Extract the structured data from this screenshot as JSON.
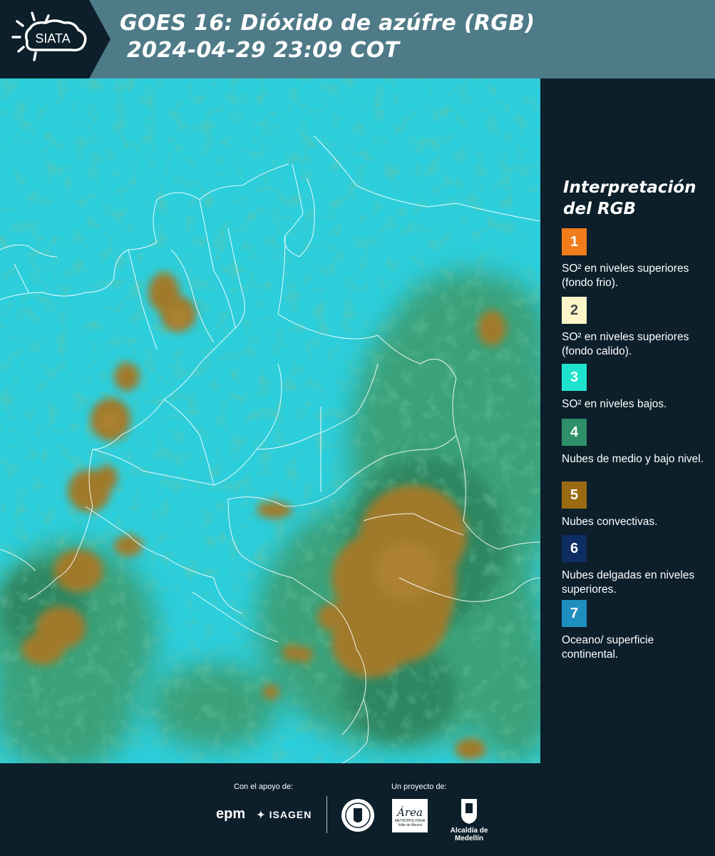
{
  "header": {
    "logo_text": "SIATA",
    "title_line1": "GOES 16: Dióxido de azúfre (RGB)",
    "title_line2": "2024-04-29 23:09 COT"
  },
  "legend": {
    "title_line1": "Interpretación",
    "title_line2": "del RGB",
    "items": [
      {
        "number": "1",
        "color": "#f07d1b",
        "text_color": "#ffffff",
        "label": "SO² en niveles superiores (fondo frio)."
      },
      {
        "number": "2",
        "color": "#fbf5c8",
        "text_color": "#444444",
        "label": "SO² en niveles superiores (fondo calido)."
      },
      {
        "number": "3",
        "color": "#1ee3cf",
        "text_color": "#ffffff",
        "label": "SO² en niveles bajos."
      },
      {
        "number": "4",
        "color": "#2e8f6a",
        "text_color": "#ffffff",
        "label": "Nubes de medio y bajo nivel."
      },
      {
        "number": "5",
        "color": "#9a6a12",
        "text_color": "#ffffff",
        "label": "Nubes convectivas."
      },
      {
        "number": "6",
        "color": "#0e2d63",
        "text_color": "#ffffff",
        "label": "Nubes delgadas en niveles superiores."
      },
      {
        "number": "7",
        "color": "#1f8fc0",
        "text_color": "#ffffff",
        "label": "Oceano/ superficie continental."
      }
    ]
  },
  "footer": {
    "support_label": "Con el apoyo de:",
    "project_label": "Un proyecto de:",
    "logo_epm": "epm",
    "logo_isagen": "ISAGEN",
    "logo_area": "Área",
    "logo_area_sub": "METROPOLITANA",
    "logo_area_sub2": "Valle de Aburrá",
    "logo_alcaldia": "Alcaldía de Medellín"
  },
  "colors": {
    "header_bg": "#4f7b88",
    "logo_bg": "#0c1f2b",
    "page_bg": "#0c1f2b",
    "sea_cyan": "#2fd3e0",
    "convective_brown": "#a07a2a",
    "midlevel_green": "#3e9a6a"
  }
}
